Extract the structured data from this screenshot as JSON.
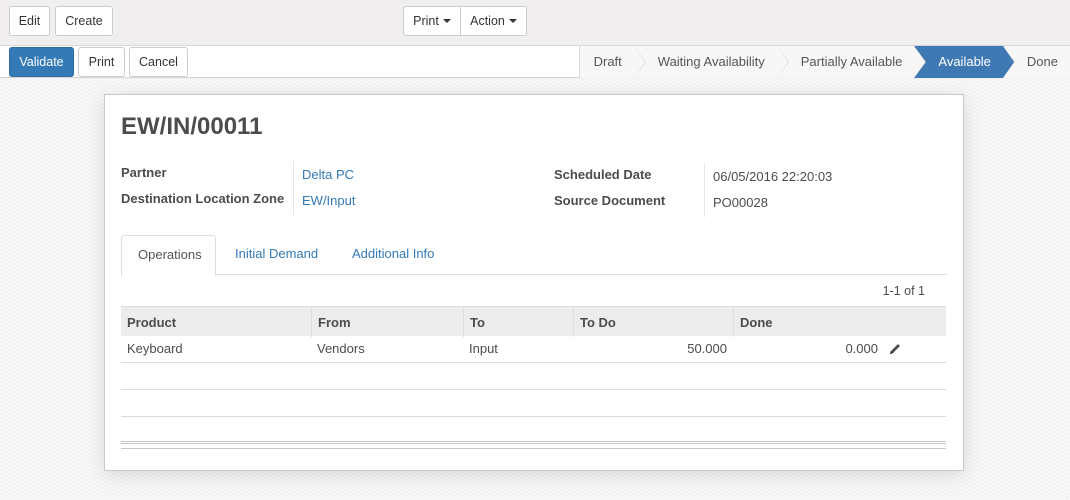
{
  "toolbar": {
    "edit": "Edit",
    "create": "Create",
    "print": "Print",
    "action": "Action"
  },
  "statusbar": {
    "validate": "Validate",
    "print": "Print",
    "cancel": "Cancel",
    "stages": [
      "Draft",
      "Waiting Availability",
      "Partially Available",
      "Available",
      "Done"
    ],
    "active_stage": "Available"
  },
  "record": {
    "title": "EW/IN/00011",
    "partner_label": "Partner",
    "partner_value": "Delta PC",
    "dest_label": "Destination Location Zone",
    "dest_value": "EW/Input",
    "sched_label": "Scheduled Date",
    "sched_value": "06/05/2016 22:20:03",
    "source_label": "Source Document",
    "source_value": "PO00028"
  },
  "tabs": [
    "Operations",
    "Initial Demand",
    "Additional Info"
  ],
  "pager": "1-1 of 1",
  "table": {
    "columns": [
      "Product",
      "From",
      "To",
      "To Do",
      "Done"
    ],
    "rows": [
      {
        "product": "Keyboard",
        "from": "Vendors",
        "to": "Input",
        "todo": "50.000",
        "done": "0.000"
      }
    ]
  },
  "colors": {
    "primary": "#337ab7",
    "active_stage": "#3e79b4"
  }
}
